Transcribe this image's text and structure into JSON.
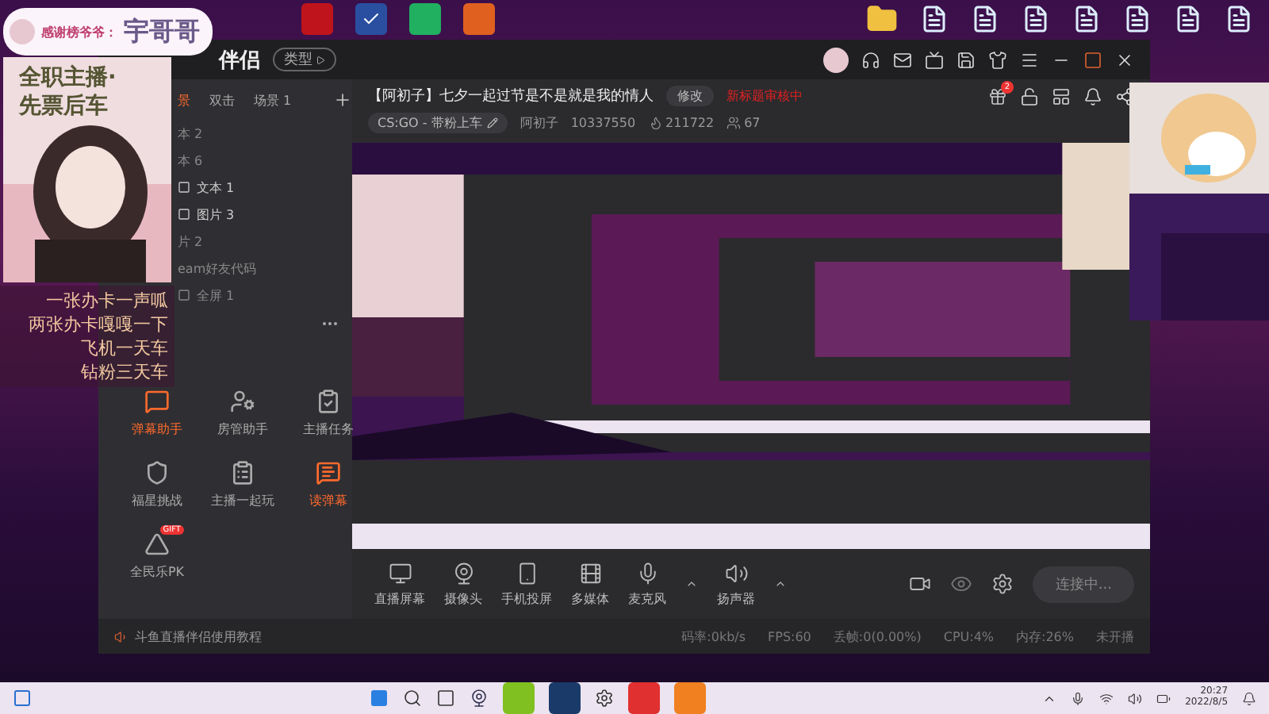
{
  "overlay": {
    "banner_label": "感谢榜爷爷：",
    "banner_name": "宇哥哥",
    "photo_caption": [
      "全职主播·",
      "先票后车"
    ],
    "lines": [
      "一张办卡一声呱",
      "两张办卡嘎嘎一下",
      "飞机一天车",
      "钻粉三天车"
    ]
  },
  "window": {
    "title": "伴侣",
    "badge": "类型"
  },
  "scene_tabs": [
    {
      "label": "景",
      "selected": true
    },
    {
      "label": "双击",
      "selected": false
    },
    {
      "label": "场景 1",
      "selected": false
    }
  ],
  "sources": [
    {
      "label": "本 2",
      "kind": "plain"
    },
    {
      "label": "本 6",
      "kind": "plain"
    },
    {
      "label": "文本 1",
      "kind": "checkbox"
    },
    {
      "label": "图片 3",
      "kind": "checkbox"
    },
    {
      "label": "片 2",
      "kind": "plain"
    },
    {
      "label": "eam好友代码",
      "kind": "plain"
    },
    {
      "label": "全屏 1",
      "kind": "frame"
    }
  ],
  "tools": [
    {
      "label": "弹幕助手",
      "kind": "danmaku",
      "selected": true
    },
    {
      "label": "房管助手",
      "kind": "admin",
      "selected": false
    },
    {
      "label": "主播任务",
      "kind": "task",
      "selected": false
    },
    {
      "label": "福星挑战",
      "kind": "shield",
      "selected": false
    },
    {
      "label": "主播一起玩",
      "kind": "clipboard",
      "selected": false
    },
    {
      "label": "读弹幕",
      "kind": "read",
      "selected": true
    },
    {
      "label": "全民乐PK",
      "kind": "pk",
      "selected": false,
      "badge": "GIFT"
    }
  ],
  "stream": {
    "title": "【阿初子】七夕一起过节是不是就是我的情人",
    "edit_button": "修改",
    "review_status": "新标题审核中",
    "category": "CS:GO - 带粉上车",
    "streamer": "阿初子",
    "room_id": "10337550",
    "heat": "211722",
    "viewers": "67",
    "gift_count": "2"
  },
  "toolbar": [
    {
      "label": "直播屏幕",
      "kind": "screen"
    },
    {
      "label": "摄像头",
      "kind": "camera"
    },
    {
      "label": "手机投屏",
      "kind": "phone"
    },
    {
      "label": "多媒体",
      "kind": "media"
    },
    {
      "label": "麦克风",
      "kind": "mic"
    },
    {
      "label": "扬声器",
      "kind": "speaker"
    }
  ],
  "connect_button": "连接中...",
  "footer": {
    "tutorial": "斗鱼直播伴侣使用教程",
    "stats": [
      "码率:0kb/s",
      "FPS:60",
      "丢帧:0(0.00%)",
      "CPU:4%",
      "内存:26%",
      "未开播"
    ]
  },
  "taskbar": {
    "time": "20:27",
    "date": "2022/8/5"
  }
}
